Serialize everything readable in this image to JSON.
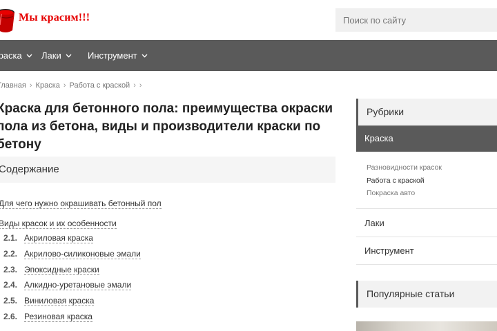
{
  "header": {
    "logo_text": "Мы красим!!!",
    "search_placeholder": "Поиск по сайту"
  },
  "nav": {
    "items": [
      {
        "label": "Краска"
      },
      {
        "label": "Лаки"
      },
      {
        "label": "Инструмент"
      }
    ]
  },
  "breadcrumb": {
    "items": [
      "Главная",
      "Краска",
      "Работа с краской"
    ]
  },
  "article": {
    "title": "Краска для бетонного пола: преимущества окраски пола из бетона, виды и производители краски по бетону"
  },
  "toc": {
    "heading": "Содержание",
    "items": [
      {
        "label": "Для чего нужно окрашивать бетонный пол"
      },
      {
        "label": "Виды красок и их особенности"
      },
      {
        "num": "2.1.",
        "label": "Акриловая краска"
      },
      {
        "num": "2.2.",
        "label": "Акрилово-силиконовые эмали"
      },
      {
        "num": "2.3.",
        "label": "Эпоксидные краски"
      },
      {
        "num": "2.4.",
        "label": "Алкидно-уретановые эмали"
      },
      {
        "num": "2.5.",
        "label": "Виниловая краска"
      },
      {
        "num": "2.6.",
        "label": "Резиновая краска"
      }
    ]
  },
  "sidebar": {
    "rubrics_heading": "Рубрики",
    "active_category": "Краска",
    "subcategories": [
      "Разновидности красок",
      "Работа с краской",
      "Покраска авто"
    ],
    "categories": [
      "Лаки",
      "Инструмент"
    ],
    "popular_heading": "Популярные статьи"
  },
  "colors": {
    "logo": "#e60000",
    "nav_bg": "#5a5a5a",
    "panel_bg": "#f2f2f2"
  }
}
